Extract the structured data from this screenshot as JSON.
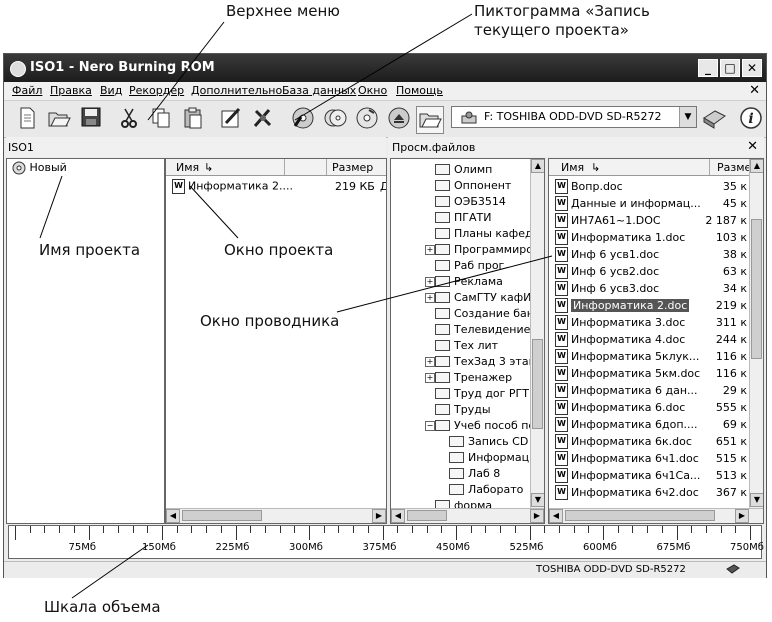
{
  "callouts": {
    "top_menu": "Верхнее меню",
    "record_icon_line1": "Пиктограмма «Запись",
    "record_icon_line2": "текущего проекта»",
    "project_name": "Имя проекта",
    "project_window": "Окно проекта",
    "explorer_window": "Окно проводника",
    "volume_scale": "Шкала объема"
  },
  "window": {
    "title": "ISO1 - Nero Burning ROM",
    "controls": {
      "minimize": "_",
      "maximize": "□",
      "close": "✕"
    }
  },
  "menu": {
    "items": [
      "Файл",
      "Правка",
      "Вид",
      "Рекордер",
      "Дополнительно",
      "База данных",
      "Окно",
      "Помощь"
    ],
    "close": "✕"
  },
  "toolbar": {
    "icons": [
      "new-icon",
      "open-icon",
      "save-icon",
      "cut-icon",
      "copy-icon",
      "paste-icon",
      "compile-icon",
      "burn-settings-icon",
      "burn-icon",
      "copy-disc-icon",
      "disc-info-icon",
      "eject-icon",
      "browser-icon"
    ],
    "drive": "F: TOSHIBA  ODD-DVD SD-R5272",
    "info": "i"
  },
  "left_panel": {
    "title": "ISO1",
    "tree_root": "Новый",
    "columns": {
      "name": "Имя",
      "size": "Размер"
    },
    "files": [
      {
        "name": "Информатика 2....",
        "size": "219 КБ",
        "extra": "Д"
      }
    ]
  },
  "right_panel": {
    "title": "Просм.файлов",
    "close": "✕",
    "folders": [
      {
        "name": "Олимп",
        "expandable": false,
        "level": 1
      },
      {
        "name": "Оппонент",
        "expandable": false,
        "level": 1
      },
      {
        "name": "ОЭБ3514",
        "expandable": false,
        "level": 1
      },
      {
        "name": "ПГАТИ",
        "expandable": false,
        "level": 1
      },
      {
        "name": "Планы кафед",
        "expandable": false,
        "level": 1
      },
      {
        "name": "Программирова",
        "expandable": true,
        "level": 1
      },
      {
        "name": "Раб прог",
        "expandable": false,
        "level": 1
      },
      {
        "name": "Реклама",
        "expandable": true,
        "level": 1
      },
      {
        "name": "СамГТУ кафИ",
        "expandable": true,
        "level": 1
      },
      {
        "name": "Создание бан",
        "expandable": false,
        "level": 1
      },
      {
        "name": "Телевидение",
        "expandable": false,
        "level": 1
      },
      {
        "name": "Тех лит",
        "expandable": false,
        "level": 1
      },
      {
        "name": "ТехЗад 3 этап",
        "expandable": true,
        "level": 1
      },
      {
        "name": "Тренажер",
        "expandable": true,
        "level": 1
      },
      {
        "name": "Труд дог РГТ",
        "expandable": false,
        "level": 1
      },
      {
        "name": "Труды",
        "expandable": false,
        "level": 1
      },
      {
        "name": "Учеб пособ пс",
        "expandable": true,
        "level": 1
      },
      {
        "name": "Запись CD",
        "expandable": false,
        "level": 2
      },
      {
        "name": "Информац",
        "expandable": false,
        "level": 2
      },
      {
        "name": "Лаб 8",
        "expandable": false,
        "level": 2
      },
      {
        "name": "Лаборато",
        "expandable": false,
        "level": 2
      },
      {
        "name": "форма",
        "expandable": false,
        "level": 1
      }
    ],
    "columns": {
      "name": "Имя",
      "size": "Разме"
    },
    "files": [
      {
        "name": "Вопр.doc",
        "size": "35 к"
      },
      {
        "name": "Данные и информац...",
        "size": "45 к"
      },
      {
        "name": "ИН7А61~1.DOC",
        "size": "2 187 к"
      },
      {
        "name": "Информатика 1.doc",
        "size": "103 к"
      },
      {
        "name": "Инф 6 усв1.doc",
        "size": "38 к"
      },
      {
        "name": "Инф 6 усв2.doc",
        "size": "63 к"
      },
      {
        "name": "Инф 6 усв3.doc",
        "size": "34 к"
      },
      {
        "name": "Информатика 2.doc",
        "size": "219 к"
      },
      {
        "name": "Информатика 3.doc",
        "size": "311 к"
      },
      {
        "name": "Информатика 4.doc",
        "size": "244 к"
      },
      {
        "name": "Информатика 5клук...",
        "size": "116 к"
      },
      {
        "name": "Информатика 5км.doc",
        "size": "116 к"
      },
      {
        "name": "Информатика 6 дан...",
        "size": "29 к"
      },
      {
        "name": "Информатика 6.doc",
        "size": "555 к"
      },
      {
        "name": "Информатика 6доп....",
        "size": "69 к"
      },
      {
        "name": "Информатика 6к.doc",
        "size": "651 к"
      },
      {
        "name": "Информатика 6ч1.doc",
        "size": "515 к"
      },
      {
        "name": "Информатика 6ч1Са...",
        "size": "513 к"
      },
      {
        "name": "Информатика 6ч2.doc",
        "size": "367 к"
      }
    ],
    "selected_index": 7
  },
  "ruler": {
    "labels": [
      "75Мб",
      "150Мб",
      "225Мб",
      "300Мб",
      "375Мб",
      "450Мб",
      "525Мб",
      "600Мб",
      "675Мб",
      "750Мб"
    ]
  },
  "status": {
    "drive": "TOSHIBA  ODD-DVD SD-R5272"
  }
}
